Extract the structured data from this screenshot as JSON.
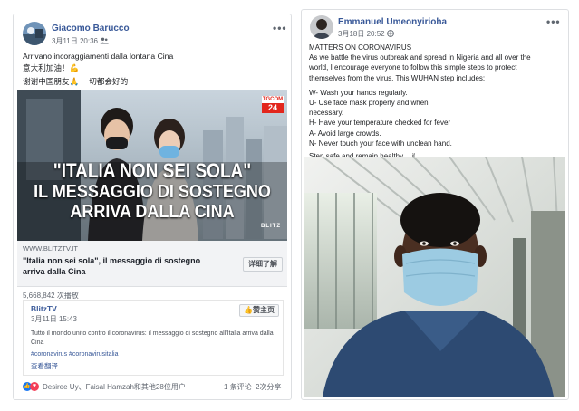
{
  "left_post": {
    "author": "Giacomo Barucco",
    "timestamp": "3月11日 20:36",
    "lines": [
      "Arrivano incoraggiamenti dalla lontana Cina",
      "意大利加油！💪",
      "谢谢中国朋友🙏 一切都会好的"
    ],
    "video": {
      "channel_badge_top": "TGCOM",
      "channel_badge_bottom": "24",
      "headline": [
        "\"ITALIA NON SEI SOLA\"",
        "IL MESSAGGIO DI SOSTEGNO",
        "ARRIVA DALLA CINA"
      ],
      "watermark": "BLITZ"
    },
    "link": {
      "domain": "WWW.BLITZTV.IT",
      "title": "\"Italia non sei sola\", il messaggio di sostegno arriva dalla Cina",
      "details_button": "详细了解"
    },
    "views": "5,668,842 次播放",
    "shared": {
      "page_name": "BlitzTV",
      "timestamp": "3月11日 15:43",
      "like_page_button": "赞主页",
      "text": "Tutto il mondo unito contro il coronavirus: il messaggio di sostegno all'Italia arriva dalla Cina",
      "hashtags": "#coronavirus #coronavirusitalia",
      "translate": "查看翻译"
    },
    "footer": {
      "reactions": "Desiree Uy、Faisal Hamzah和其他28位用户",
      "comments": "1 条评论",
      "shares": "2次分享"
    }
  },
  "right_post": {
    "author": "Emmanuel Umeonyirioha",
    "timestamp": "3月18日 20:52",
    "lines": [
      "MATTERS ON CORONAVIRUS",
      "As we battle the virus outbreak and spread in Nigeria and all over the",
      "world, I encourage everyone to follow this simple steps to protect",
      "themselves from the virus. This WUHAN step includes;",
      "",
      "W- Wash your hands regularly.",
      "U- Use face mask properly and when",
      "necessary.",
      "H- Have your temperature checked for fever",
      "A- Avoid large crowds.",
      "N- Never touch your face with unclean hand.",
      "Step safe and remain healthy... ✌"
    ]
  },
  "colors": {
    "link_blue": "#385898",
    "meta_gray": "#616770",
    "tgcom_red": "#e2261c"
  }
}
